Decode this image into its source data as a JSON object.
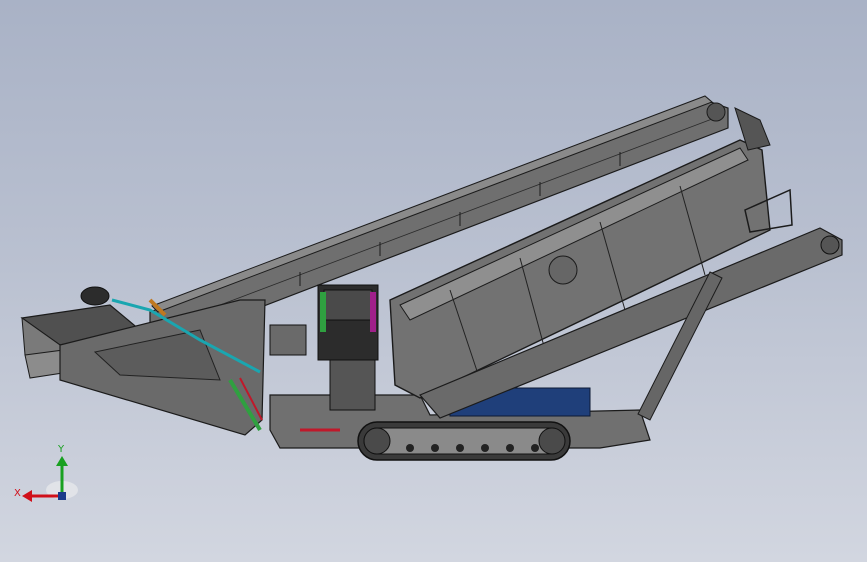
{
  "viewport": {
    "background_top": "#a9b2c6",
    "background_bottom": "#d2d6e0"
  },
  "triad": {
    "x_label": "X",
    "y_label": "Y",
    "x_color": "#d0101a",
    "y_color": "#18a020"
  },
  "model_colors": {
    "body": "#6e6e6e",
    "body_dark": "#3a3a3a",
    "edge": "#1b1b1b",
    "blue_tank": "#1f3f7a",
    "accent_red": "#c0182a",
    "accent_cyan": "#1aa6b0",
    "accent_green": "#2fa040",
    "accent_orange": "#c07820",
    "accent_magenta": "#a0208a"
  }
}
